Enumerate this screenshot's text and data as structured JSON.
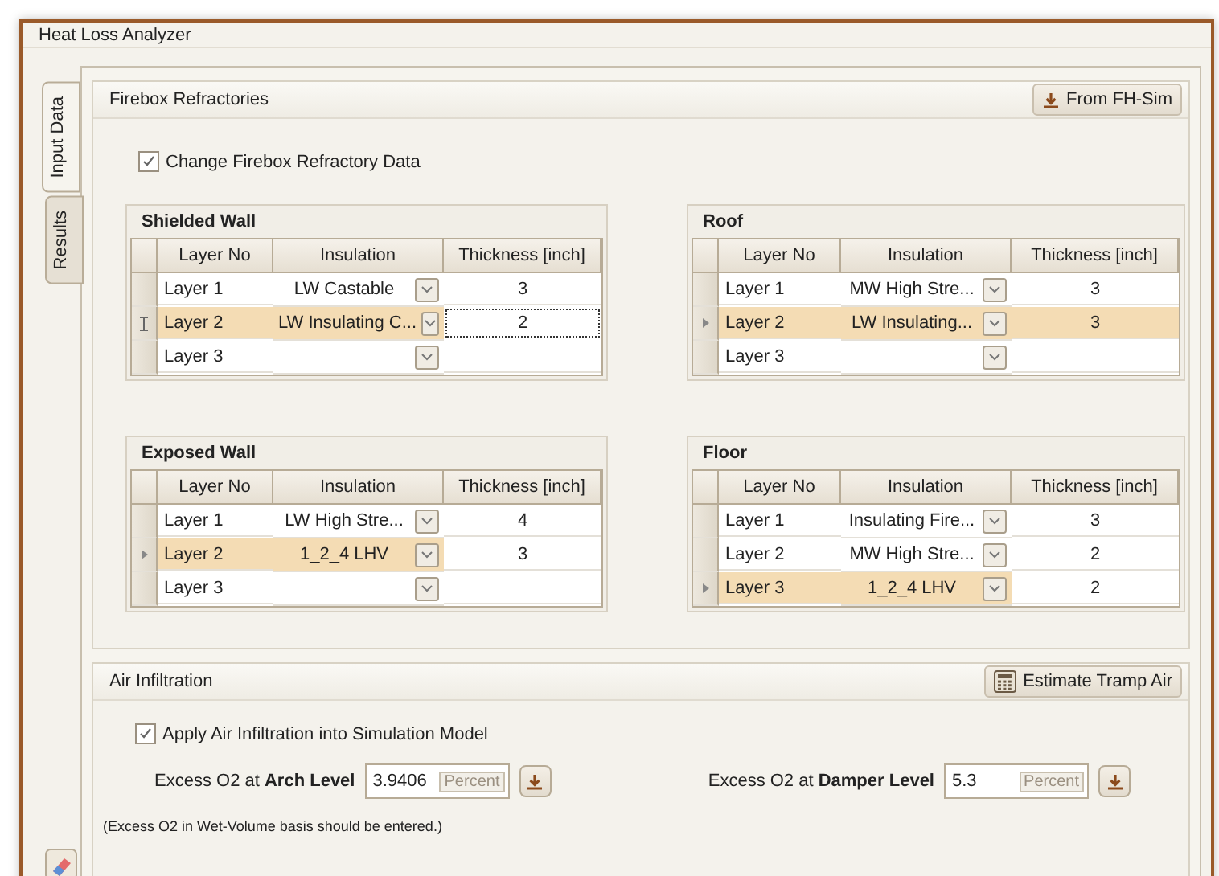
{
  "window": {
    "title": "Heat Loss Analyzer"
  },
  "side_tabs": [
    {
      "label": "Input Data",
      "selected": true
    },
    {
      "label": "Results",
      "selected": false
    }
  ],
  "firebox": {
    "title": "Firebox Refractories",
    "button": "From FH-Sim",
    "change_checkbox": {
      "label": "Change Firebox Refractory Data",
      "checked": true
    },
    "tables": [
      {
        "title": "Shielded Wall",
        "columns": [
          "Layer No",
          "Insulation",
          "Thickness [inch]"
        ],
        "rows": [
          {
            "layer": "Layer 1",
            "insulation": "LW Castable",
            "thickness": "3",
            "selected": false,
            "current": false,
            "editing": false,
            "thickness_selected": false
          },
          {
            "layer": "Layer 2",
            "insulation": "LW Insulating C...",
            "thickness": "2",
            "selected": true,
            "current": false,
            "editing": true,
            "thickness_selected": false
          },
          {
            "layer": "Layer 3",
            "insulation": "",
            "thickness": "",
            "selected": false,
            "current": false,
            "editing": false,
            "thickness_selected": false
          }
        ]
      },
      {
        "title": "Roof",
        "columns": [
          "Layer No",
          "Insulation",
          "Thickness [inch]"
        ],
        "rows": [
          {
            "layer": "Layer 1",
            "insulation": "MW High Stre...",
            "thickness": "3",
            "selected": false,
            "current": false,
            "editing": false,
            "thickness_selected": false
          },
          {
            "layer": "Layer 2",
            "insulation": "LW Insulating...",
            "thickness": "3",
            "selected": true,
            "current": true,
            "editing": false,
            "thickness_selected": true
          },
          {
            "layer": "Layer 3",
            "insulation": "",
            "thickness": "",
            "selected": false,
            "current": false,
            "editing": false,
            "thickness_selected": false
          }
        ]
      },
      {
        "title": "Exposed Wall",
        "columns": [
          "Layer No",
          "Insulation",
          "Thickness [inch]"
        ],
        "rows": [
          {
            "layer": "Layer 1",
            "insulation": "LW High Stre...",
            "thickness": "4",
            "selected": false,
            "current": false,
            "editing": false,
            "thickness_selected": false
          },
          {
            "layer": "Layer 2",
            "insulation": "1_2_4 LHV",
            "thickness": "3",
            "selected": true,
            "current": true,
            "editing": false,
            "thickness_selected": false
          },
          {
            "layer": "Layer 3",
            "insulation": "",
            "thickness": "",
            "selected": false,
            "current": false,
            "editing": false,
            "thickness_selected": false
          }
        ]
      },
      {
        "title": "Floor",
        "columns": [
          "Layer No",
          "Insulation",
          "Thickness [inch]"
        ],
        "rows": [
          {
            "layer": "Layer 1",
            "insulation": "Insulating Fire...",
            "thickness": "3",
            "selected": false,
            "current": false,
            "editing": false,
            "thickness_selected": false
          },
          {
            "layer": "Layer 2",
            "insulation": "MW High Stre...",
            "thickness": "2",
            "selected": false,
            "current": false,
            "editing": false,
            "thickness_selected": false
          },
          {
            "layer": "Layer 3",
            "insulation": "1_2_4 LHV",
            "thickness": "2",
            "selected": true,
            "current": true,
            "editing": false,
            "thickness_selected": false
          }
        ]
      }
    ]
  },
  "air": {
    "title": "Air Infiltration",
    "button": "Estimate Tramp Air",
    "apply_checkbox": {
      "label": "Apply Air Infiltration into Simulation Model",
      "checked": true
    },
    "fields": [
      {
        "label": "Excess O2 at **Arch Level**",
        "value": "3.9406",
        "unit": "Percent"
      },
      {
        "label": "Excess O2 at **Damper Level**",
        "value": "5.3",
        "unit": "Percent"
      }
    ],
    "note": "(Excess O2 in Wet-Volume basis should be entered.)"
  }
}
